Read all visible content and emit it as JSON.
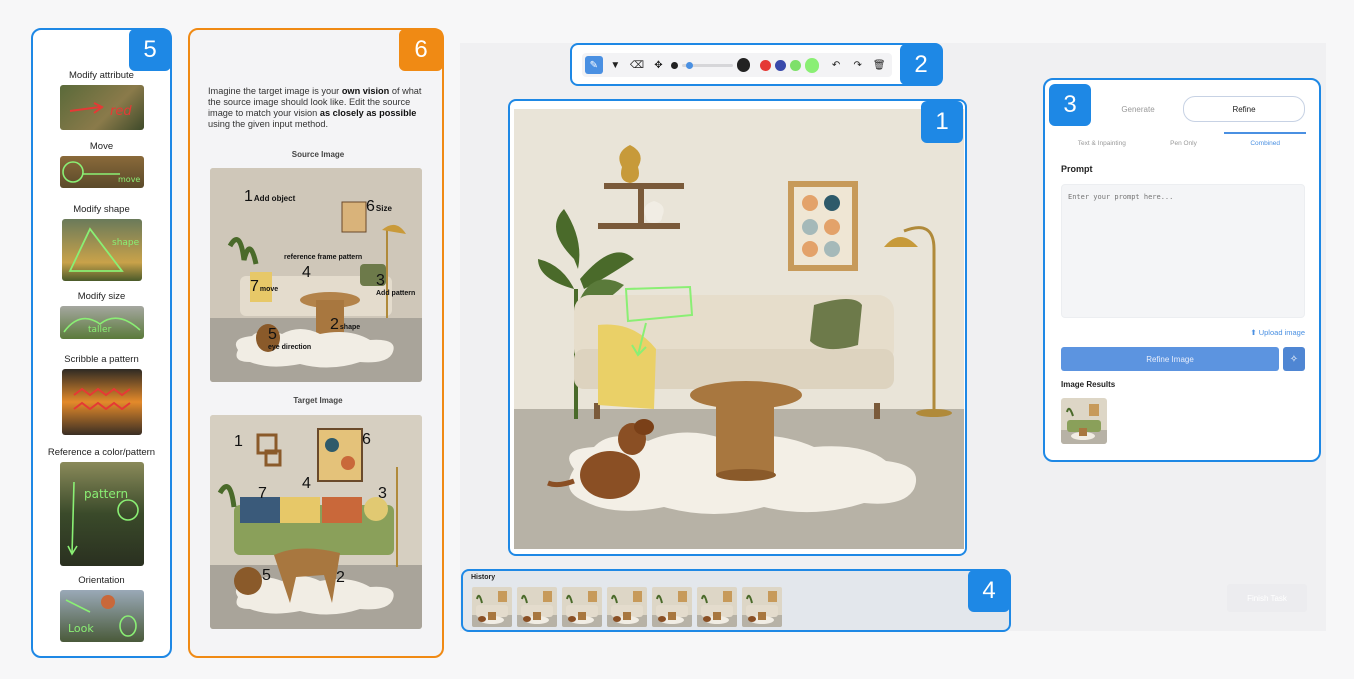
{
  "panel5": {
    "badge": "5",
    "examples": [
      {
        "label": "Modify attribute",
        "scribble": "red"
      },
      {
        "label": "Move",
        "scribble": "move"
      },
      {
        "label": "Modify shape",
        "scribble": "shape"
      },
      {
        "label": "Modify size",
        "scribble": "taller"
      },
      {
        "label": "Scribble a pattern",
        "scribble": ""
      },
      {
        "label": "Reference a color/pattern",
        "scribble": "pattern"
      },
      {
        "label": "Orientation",
        "scribble": "Look"
      }
    ]
  },
  "panel6": {
    "badge": "6",
    "instruction_1": "Imagine the target image is your ",
    "instruction_bold_1": "own vision",
    "instruction_2": " of what the source image should look like. Edit the source image to match your vision ",
    "instruction_bold_2": "as closely as possible",
    "instruction_3": " using the given input method.",
    "source_title": "Source Image",
    "target_title": "Target Image",
    "source_annotations": [
      {
        "num": "1",
        "text": "Add object"
      },
      {
        "num": "6",
        "text": "Size"
      },
      {
        "num": "",
        "text": "reference frame pattern"
      },
      {
        "num": "4",
        "text": ""
      },
      {
        "num": "3",
        "text": "Add pattern"
      },
      {
        "num": "7",
        "text": "move"
      },
      {
        "num": "2",
        "text": "shape"
      },
      {
        "num": "5",
        "text": "eye direction"
      }
    ],
    "target_annotations": [
      "1",
      "6",
      "7",
      "4",
      "3",
      "5",
      "2"
    ]
  },
  "toolbar": {
    "badge": "2",
    "colors": [
      "#222222",
      "#e53935",
      "#3949ab",
      "#7ee06a",
      "#8aef74"
    ]
  },
  "canvas": {
    "badge": "1"
  },
  "history": {
    "badge": "4",
    "title": "History",
    "count": 7
  },
  "panel3": {
    "badge": "3",
    "tab_generate": "Generate",
    "tab_refine": "Refine",
    "subtab_text": "Text & Inpainting",
    "subtab_pen": "Pen Only",
    "subtab_combined": "Combined",
    "prompt_label": "Prompt",
    "prompt_placeholder": "Enter your prompt here...",
    "upload_label": "Upload image",
    "refine_button": "Refine Image",
    "results_label": "Image Results"
  },
  "finish_button": "Finish Task"
}
